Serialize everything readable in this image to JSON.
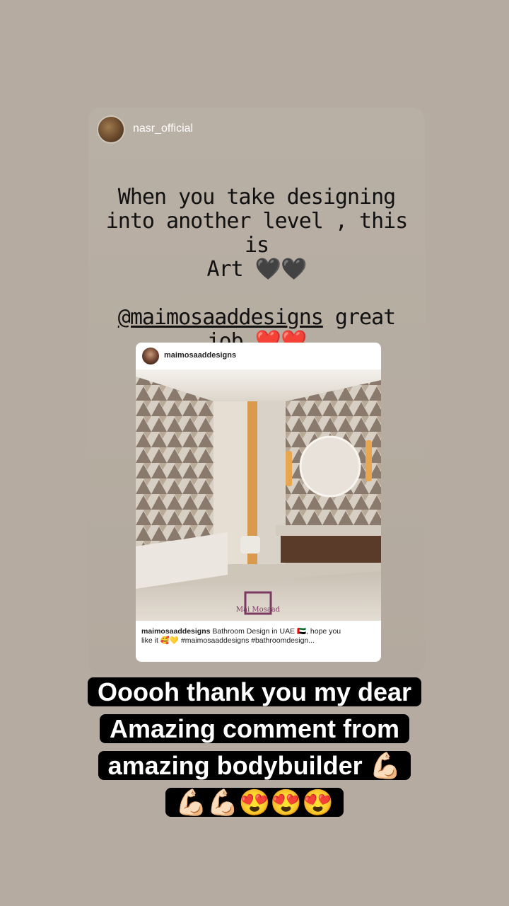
{
  "story": {
    "author": "nasr_official",
    "text_lines": [
      "When you take designing",
      "into another level , this is",
      "Art 🖤🖤"
    ],
    "mention": "@maimosaaddesigns",
    "mention_suffix": " great",
    "mention_line2": "job ❤️❤️"
  },
  "embed": {
    "user": "maimosaaddesigns",
    "caption_user": "maimosaaddesigns",
    "caption_line1": " Bathroom Design in UAE 🇦🇪, hope you",
    "caption_line2": "like it 🥰💛 #maimosaaddesigns #bathroomdesign...",
    "watermark": "Mai Mosaad"
  },
  "reply": {
    "lines": [
      "Ooooh thank you my dear",
      "Amazing comment from",
      "amazing bodybuilder 💪🏻",
      "💪🏻💪🏻😍😍😍"
    ]
  }
}
